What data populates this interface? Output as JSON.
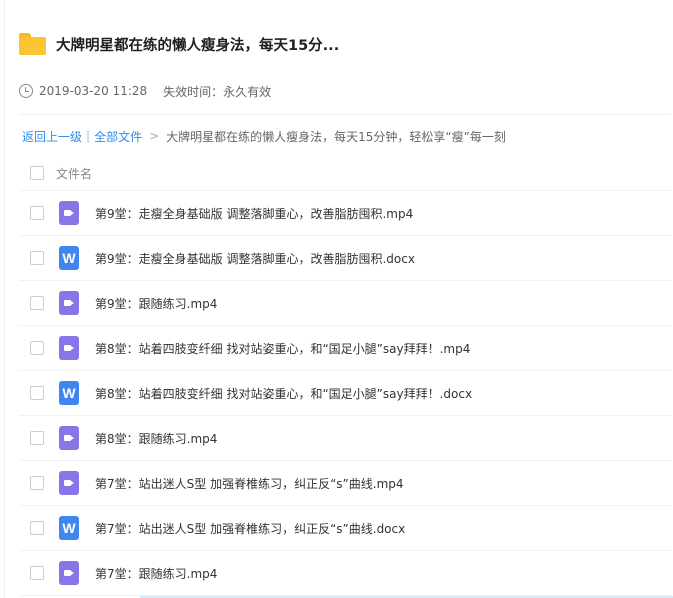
{
  "header": {
    "title": "大牌明星都在练的懒人瘦身法，每天15分..."
  },
  "meta": {
    "date": "2019-03-20 11:28",
    "expire_label": "失效时间：",
    "expire_value": "永久有效"
  },
  "breadcrumb": {
    "back": "返回上一级",
    "separator": "|",
    "all_files": "全部文件",
    "chevron": ">",
    "current": "大牌明星都在练的懒人瘦身法，每天15分钟，轻松享“瘦”每一刻"
  },
  "list": {
    "column_header": "文件名",
    "files": [
      {
        "type": "video-icon",
        "name": "第9堂：走瘦全身基础版 调整落脚重心，改善脂肪囤积.mp4"
      },
      {
        "type": "word-icon",
        "icon_letter": "W",
        "name": "第9堂：走瘦全身基础版 调整落脚重心，改善脂肪囤积.docx"
      },
      {
        "type": "video-icon",
        "name": "第9堂：跟随练习.mp4"
      },
      {
        "type": "video-icon",
        "name": "第8堂：站着四肢变纤细 找对站姿重心，和“国足小腿”say拜拜！.mp4"
      },
      {
        "type": "word-icon",
        "icon_letter": "W",
        "name": "第8堂：站着四肢变纤细 找对站姿重心，和“国足小腿”say拜拜！.docx"
      },
      {
        "type": "video-icon",
        "name": "第8堂：跟随练习.mp4"
      },
      {
        "type": "video-icon",
        "name": "第7堂：站出迷人S型 加强脊椎练习，纠正反“s”曲线.mp4"
      },
      {
        "type": "word-icon",
        "icon_letter": "W",
        "name": "第7堂：站出迷人S型 加强脊椎练习，纠正反“s”曲线.docx"
      },
      {
        "type": "video-icon",
        "name": "第7堂：跟随练习.mp4"
      }
    ]
  },
  "colors": {
    "link": "#2d8cf0",
    "folder": "#fcc431",
    "video_icon": "#8a75e8",
    "word_icon": "#3f86f0"
  }
}
